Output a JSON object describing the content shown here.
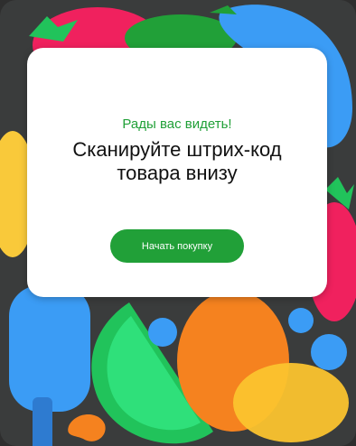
{
  "card": {
    "greeting": "Рады вас видеть!",
    "title_line1": "Сканируйте штрих-код",
    "title_line2": "товара внизу"
  },
  "actions": {
    "start_label": "Начать покупку"
  },
  "colors": {
    "accent": "#21a038",
    "card_bg": "#ffffff",
    "screen_bg": "#3a3c3c"
  }
}
